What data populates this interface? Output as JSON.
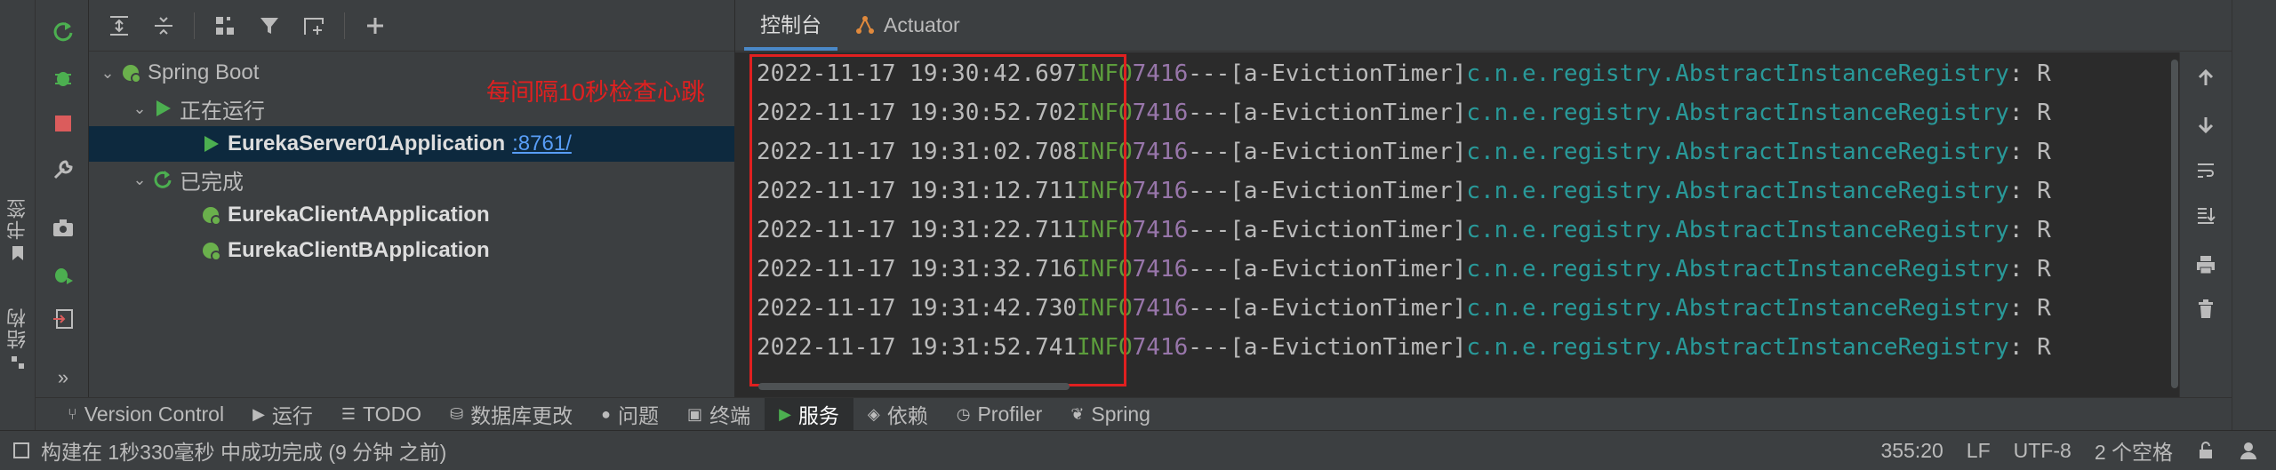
{
  "left_stripe": {
    "bookmarks_label": "书签",
    "structure_label": "结构"
  },
  "tree": {
    "annotation": "每间隔10秒检查心跳",
    "root_label": "Spring Boot",
    "running_group": "正在运行",
    "running_app": "EurekaServer01Application",
    "running_app_port": ":8761/",
    "finished_group": "已完成",
    "finished_apps": [
      "EurekaClientAApplication",
      "EurekaClientBApplication"
    ]
  },
  "console_tabs": [
    "控制台",
    "Actuator"
  ],
  "log_lines": [
    {
      "time": "2022-11-17 19:30:42.697",
      "level": "INFO",
      "pid": "7416",
      "sep": "---",
      "thread": "[a-EvictionTimer]",
      "logger": "c.n.e.registry.AbstractInstanceRegistry",
      "msg": ": R"
    },
    {
      "time": "2022-11-17 19:30:52.702",
      "level": "INFO",
      "pid": "7416",
      "sep": "---",
      "thread": "[a-EvictionTimer]",
      "logger": "c.n.e.registry.AbstractInstanceRegistry",
      "msg": ": R"
    },
    {
      "time": "2022-11-17 19:31:02.708",
      "level": "INFO",
      "pid": "7416",
      "sep": "---",
      "thread": "[a-EvictionTimer]",
      "logger": "c.n.e.registry.AbstractInstanceRegistry",
      "msg": ": R"
    },
    {
      "time": "2022-11-17 19:31:12.711",
      "level": "INFO",
      "pid": "7416",
      "sep": "---",
      "thread": "[a-EvictionTimer]",
      "logger": "c.n.e.registry.AbstractInstanceRegistry",
      "msg": ": R"
    },
    {
      "time": "2022-11-17 19:31:22.711",
      "level": "INFO",
      "pid": "7416",
      "sep": "---",
      "thread": "[a-EvictionTimer]",
      "logger": "c.n.e.registry.AbstractInstanceRegistry",
      "msg": ": R"
    },
    {
      "time": "2022-11-17 19:31:32.716",
      "level": "INFO",
      "pid": "7416",
      "sep": "---",
      "thread": "[a-EvictionTimer]",
      "logger": "c.n.e.registry.AbstractInstanceRegistry",
      "msg": ": R"
    },
    {
      "time": "2022-11-17 19:31:42.730",
      "level": "INFO",
      "pid": "7416",
      "sep": "---",
      "thread": "[a-EvictionTimer]",
      "logger": "c.n.e.registry.AbstractInstanceRegistry",
      "msg": ": R"
    },
    {
      "time": "2022-11-17 19:31:52.741",
      "level": "INFO",
      "pid": "7416",
      "sep": "---",
      "thread": "[a-EvictionTimer]",
      "logger": "c.n.e.registry.AbstractInstanceRegistry",
      "msg": ": R"
    }
  ],
  "bottom_tabs": [
    "Version Control",
    "运行",
    "TODO",
    "数据库更改",
    "问题",
    "终端",
    "服务",
    "依赖",
    "Profiler",
    "Spring"
  ],
  "bottom_tab_active": "服务",
  "status": {
    "message": "构建在 1秒330毫秒 中成功完成 (9 分钟 之前)",
    "position": "355:20",
    "line_sep": "LF",
    "encoding": "UTF-8",
    "indent": "2 个空格"
  },
  "colors": {
    "accent": "#4a88c7",
    "annotation_red": "#e02020",
    "log_info": "#5c9c3c",
    "log_pid": "#9876aa",
    "log_logger": "#299999",
    "run_green": "#4caf50"
  }
}
